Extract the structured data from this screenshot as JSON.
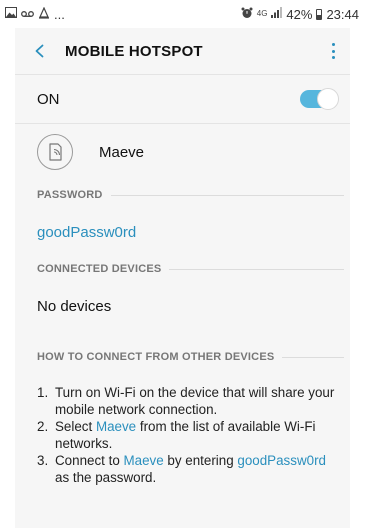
{
  "status_bar": {
    "network": "4G",
    "battery": "42%",
    "time": "23:44",
    "left_more": "..."
  },
  "app_bar": {
    "title": "MOBILE HOTSPOT"
  },
  "hotspot": {
    "on_label": "ON",
    "enabled": true,
    "network_name": "Maeve"
  },
  "password_section": {
    "header": "PASSWORD",
    "value": "goodPassw0rd"
  },
  "connected_section": {
    "header": "CONNECTED DEVICES",
    "value": "No devices"
  },
  "howto_section": {
    "header": "HOW TO CONNECT FROM OTHER DEVICES",
    "steps": [
      {
        "num": "1.",
        "text": "Turn on Wi-Fi on the device that will share your mobile network connection."
      },
      {
        "num": "2.",
        "pre": "Select ",
        "highlight": "Maeve",
        "post": " from the list of available Wi-Fi networks."
      },
      {
        "num": "3.",
        "pre": "Connect to ",
        "highlight": "Maeve",
        "mid": " by entering ",
        "highlight2": "goodPassw0rd",
        "post": " as the password."
      }
    ]
  },
  "colors": {
    "accent": "#2a8fbd",
    "toggle_track": "#56b6dd",
    "panel_bg": "#f6f6f6"
  }
}
